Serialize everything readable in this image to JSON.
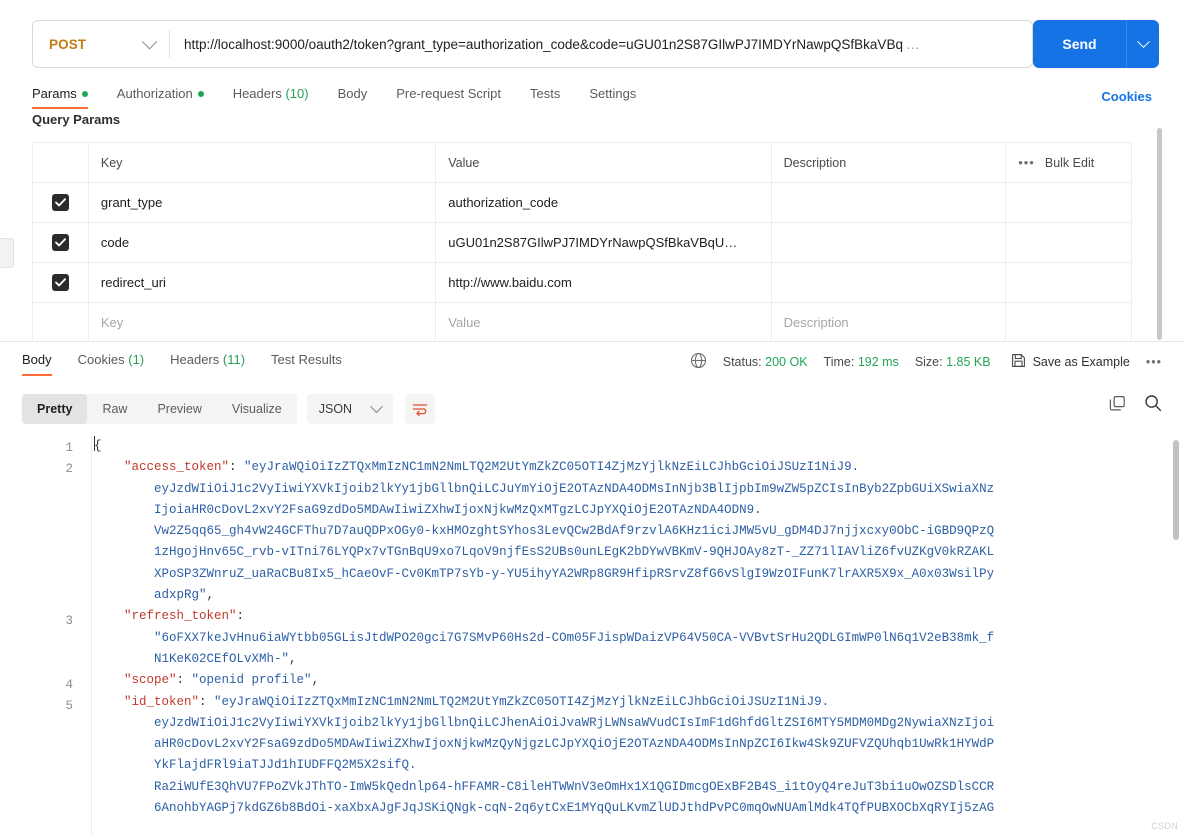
{
  "request": {
    "method": "POST",
    "url": "http://localhost:9000/oauth2/token?grant_type=authorization_code&code=uGU01n2S87GIlwPJ7IMDYrNawpQSfBkaVBq",
    "url_ellipsis": "…",
    "send_label": "Send",
    "tabs": [
      {
        "label": "Params",
        "dot": true,
        "active": true
      },
      {
        "label": "Authorization",
        "dot": true,
        "active": false
      },
      {
        "label": "Headers",
        "count": "(10)",
        "active": false
      },
      {
        "label": "Body",
        "active": false
      },
      {
        "label": "Pre-request Script",
        "active": false
      },
      {
        "label": "Tests",
        "active": false
      },
      {
        "label": "Settings",
        "active": false
      }
    ],
    "cookies_link": "Cookies"
  },
  "params": {
    "section_title": "Query Params",
    "columns": [
      "Key",
      "Value",
      "Description"
    ],
    "bulk_edit_label": "Bulk Edit",
    "rows": [
      {
        "checked": true,
        "key": "grant_type",
        "value": "authorization_code",
        "description": ""
      },
      {
        "checked": true,
        "key": "code",
        "value": "uGU01n2S87GIlwPJ7IMDYrNawpQSfBkaVBqU…",
        "description": ""
      },
      {
        "checked": true,
        "key": "redirect_uri",
        "value": "http://www.baidu.com",
        "description": ""
      }
    ],
    "empty_row": {
      "key": "Key",
      "value": "Value",
      "description": "Description"
    }
  },
  "response": {
    "tabs": [
      {
        "label": "Body",
        "active": true
      },
      {
        "label": "Cookies",
        "count": "(1)",
        "active": false
      },
      {
        "label": "Headers",
        "count": "(11)",
        "active": false
      },
      {
        "label": "Test Results",
        "active": false
      }
    ],
    "status_label": "Status:",
    "status_value": "200 OK",
    "time_label": "Time:",
    "time_value": "192 ms",
    "size_label": "Size:",
    "size_value": "1.85 KB",
    "save_as_example": "Save as Example",
    "view_modes": [
      "Pretty",
      "Raw",
      "Preview",
      "Visualize"
    ],
    "active_view_mode": "Pretty",
    "format": "JSON",
    "line_numbers": [
      "1",
      "2",
      "3",
      "4",
      "5"
    ],
    "body_lines": [
      "{",
      "    \"access_token\": \"eyJraWQiOiIzZTQxMmIzNC1mN2NmLTQ2M2UtYmZkZC05OTI4ZjMzYjlkNzEiLCJhbGciOiJSUzI1NiJ9.",
      "        eyJzdWIiOiJ1c2VyIiwiYXVkIjoib2lkYy1jbGllbnQiLCJuYmYiOjE2OTAzNDA4ODMsInNjb3BlIjpbIm9wZW5pZCIsInByb2ZpbGUiXSwiaXNz",
      "        IjoiaHR0cDovL2xvY2FsaG9zdDo5MDAwIiwiZXhwIjoxNjkwMzQxMTgzLCJpYXQiOjE2OTAzNDA4ODN9.",
      "        Vw2Z5qq65_gh4vW24GCFThu7D7auQDPxOGy0-kxHMOzghtSYhos3LevQCw2BdAf9rzvlA6KHz1iciJMW5vU_gDM4DJ7njjxcxy0ObC-iGBD9QPzQ",
      "        1zHgojHnv65C_rvb-vITni76LYQPx7vTGnBqU9xo7LqoV9njfEsS2UBs0unLEgK2bDYwVBKmV-9QHJOAy8zT-_ZZ71lIAVliZ6fvUZKgV0kRZAKL",
      "        XPoSP3ZWnruZ_uaRaCBu8Ix5_hCaeOvF-Cv0KmTP7sYb-y-YU5ihyYA2WRp8GR9HfipRSrvZ8fG6vSlgI9WzOIFunK7lrAXR5X9x_A0x03WsilPy",
      "        adxpRg\",",
      "    \"refresh_token\":",
      "        \"6oFXX7keJvHnu6iaWYtbb05GLisJtdWPO20gci7G7SMvP60Hs2d-COm05FJispWDaizVP64V50CA-VVBvtSrHu2QDLGImWP0lN6q1V2eB38mk_f",
      "        N1KeK02CEfOLvXMh-\",",
      "    \"scope\": \"openid profile\",",
      "    \"id_token\": \"eyJraWQiOiIzZTQxMmIzNC1mN2NmLTQ2M2UtYmZkZC05OTI4ZjMzYjlkNzEiLCJhbGciOiJSUzI1NiJ9.",
      "        eyJzdWIiOiJ1c2VyIiwiYXVkIjoib2lkYy1jbGllbnQiLCJhenAiOiJvaWRjLWNsaWVudCIsImF1dGhfdGltZSI6MTY5MDM0MDg2NywiaXNzIjoi",
      "        aHR0cDovL2xvY2FsaG9zdDo5MDAwIiwiZXhwIjoxNjkwMzQyNjgzLCJpYXQiOjE2OTAzNDA4ODMsInNpZCI6Ikw4Sk9ZUFVZQUhqb1UwRk1HYWdP",
      "        YkFlajdFRl9iaTJJd1hIUDFFQ2M5X2sifQ.",
      "        Ra2iWUfE3QhVU7FPoZVkJThTO-ImW5kQednlp64-hFFAMR-C8ileHTWWnV3eOmHx1X1QGIDmcgOExBF2B4S_i1tOyQ4reJuT3bi1uOwOZSDlsCCR",
      "        6AnohbYAGPj7kdGZ6b8BdOi-xaXbxAJgFJqJSKiQNgk-cqN-2q6ytCxE1MYqQuLKvmZlUDJthdPvPC0mqOwNUAmlMdk4TQfPUBXOCbXqRYIj5zAG"
    ],
    "watermark": "CSDN"
  },
  "colors": {
    "accent": "#ff6c37",
    "send_blue": "#1573e6",
    "method_orange": "#c07d16",
    "success_green": "#23a455",
    "json_string": "#2d5fa5",
    "json_key": "#c0392b"
  }
}
